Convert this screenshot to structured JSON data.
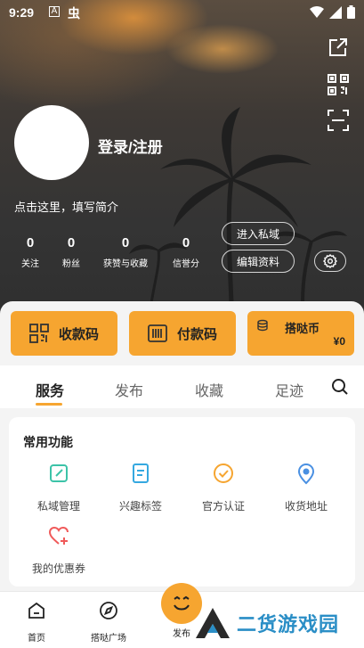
{
  "status_bar": {
    "time": "9:29",
    "a_label": "A",
    "app_glyph": "虫"
  },
  "profile": {
    "login_label": "登录/注册",
    "bio_placeholder": "点击这里，填写简介"
  },
  "stats": [
    {
      "value": "0",
      "label": "关注"
    },
    {
      "value": "0",
      "label": "粉丝"
    },
    {
      "value": "0",
      "label": "获赞与收藏"
    },
    {
      "value": "0",
      "label": "信誉分"
    }
  ],
  "actions": {
    "private_domain": "进入私域",
    "edit_profile": "编辑资料"
  },
  "payments": {
    "receive": "收款码",
    "pay": "付款码",
    "coin_label": "搭哒币",
    "coin_value": "¥0"
  },
  "tabs": [
    "服务",
    "发布",
    "收藏",
    "足迹"
  ],
  "common_functions": {
    "title": "常用功能",
    "items": [
      {
        "label": "私域管理",
        "icon": "edit-square-icon",
        "color": "#3cc3a8"
      },
      {
        "label": "兴趣标签",
        "icon": "document-icon",
        "color": "#35a8e0"
      },
      {
        "label": "官方认证",
        "icon": "check-badge-icon",
        "color": "#f6a530"
      },
      {
        "label": "收货地址",
        "icon": "location-pin-icon",
        "color": "#4a90e2"
      },
      {
        "label": "我的优惠券",
        "icon": "heart-plus-icon",
        "color": "#f05a5a"
      }
    ]
  },
  "bottom_nav": [
    {
      "label": "首页",
      "icon": "home-icon"
    },
    {
      "label": "搭哒广场",
      "icon": "compass-icon"
    },
    {
      "label": "发布",
      "icon": "publish-icon"
    }
  ],
  "watermark": {
    "text": "二货游戏园"
  },
  "colors": {
    "accent": "#f6a530",
    "watermark": "#2a8ec6"
  }
}
